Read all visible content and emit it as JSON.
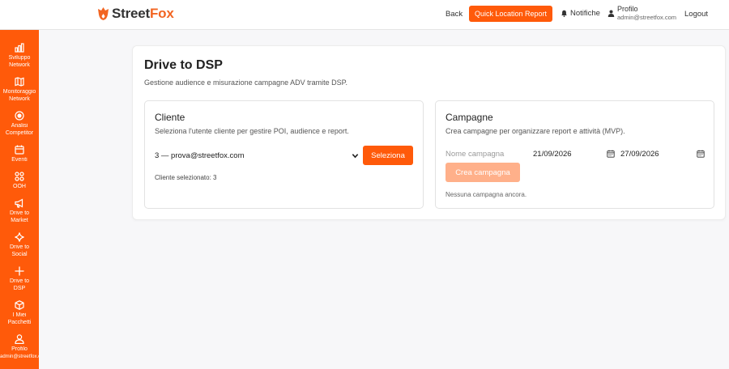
{
  "brand": {
    "name_part1": "Street",
    "name_part2": "Fox",
    "accent": "#ff5a0a"
  },
  "topnav": {
    "back_label": "Back",
    "quick_report_label": "Quick Location Report",
    "notifications_label": "Notifiche",
    "profile_name": "Profilo",
    "profile_email": "admin@streetfox.com",
    "logout_label": "Logout"
  },
  "sidebar": {
    "items": [
      {
        "label": "Sviluppo\nNetwork",
        "icon": "chart-bar-icon"
      },
      {
        "label": "Monitoraggio\nNetwork",
        "icon": "map-icon"
      },
      {
        "label": "Analisi\nCompetitor",
        "icon": "target-icon"
      },
      {
        "label": "Eventi",
        "icon": "calendar-icon"
      },
      {
        "label": "OOH",
        "icon": "grid-icon"
      },
      {
        "label": "Drive to\nMarket",
        "icon": "megaphone-icon"
      },
      {
        "label": "Drive to\nSocial",
        "icon": "sparkle-icon"
      },
      {
        "label": "Drive to\nDSP",
        "icon": "plus-icon"
      },
      {
        "label": "I Miei\nPacchetti",
        "icon": "package-icon"
      },
      {
        "label": "Profilo\nadmin@streetfox.com",
        "icon": "user-icon"
      }
    ]
  },
  "main": {
    "title": "Drive to DSP",
    "subtitle": "Gestione audience e misurazione campagne ADV tramite DSP."
  },
  "cliente": {
    "title": "Cliente",
    "description": "Seleziona l'utente cliente per gestire POI, audience e report.",
    "selected_option": "3 — prova@streetfox.com",
    "select_button": "Seleziona",
    "selected_info": "Cliente selezionato: 3"
  },
  "campagne": {
    "title": "Campagne",
    "description": "Crea campagne per organizzare report e attività (MVP).",
    "name_placeholder": "Nome campagna",
    "start_date": "21/09/2026",
    "end_date": "27/09/2026",
    "create_button": "Crea campagna",
    "empty_message": "Nessuna campagna ancora."
  }
}
